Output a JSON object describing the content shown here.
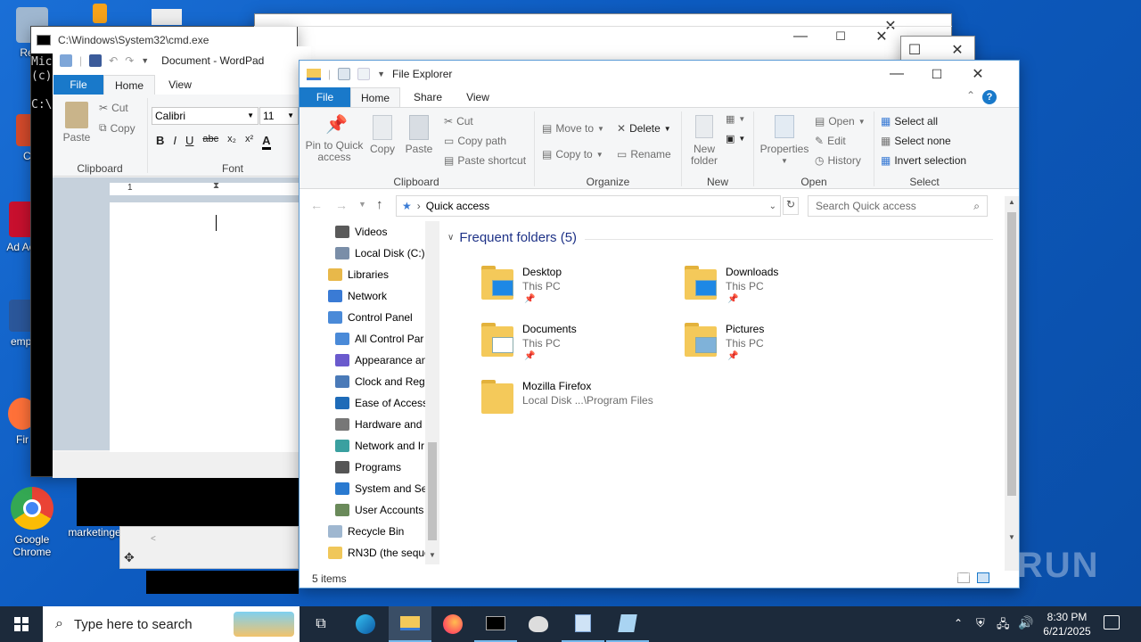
{
  "desktop": {
    "icons": [
      {
        "label": "Recy",
        "color": "#9fb7d0"
      },
      {
        "label": "CCl",
        "color": "#d44a2b"
      },
      {
        "label": "Ad Acr",
        "color": "#c8102e"
      },
      {
        "label": "empl",
        "color": "#2b579a"
      },
      {
        "label": "Fir",
        "color": "#ff7139"
      },
      {
        "label": "Google Chrome",
        "color": "#4285f4"
      },
      {
        "label": "marketinge",
        "color": "#bbbbbb"
      }
    ]
  },
  "cmd": {
    "title": "C:\\Windows\\System32\\cmd.exe",
    "lines": [
      "Mic",
      "(c)",
      "",
      "C:\\"
    ]
  },
  "wordpad": {
    "title": "Document - WordPad",
    "tabs": [
      "File",
      "Home",
      "View"
    ],
    "font_name": "Calibri",
    "font_size": "11",
    "clipboard": {
      "paste": "Paste",
      "cut": "Cut",
      "copy": "Copy",
      "group": "Clipboard"
    },
    "font_group": "Font",
    "ruler_mark": "1"
  },
  "explorer": {
    "title": "File Explorer",
    "tabs": [
      "File",
      "Home",
      "Share",
      "View"
    ],
    "ribbon": {
      "clipboard": {
        "pin": "Pin to Quick access",
        "copy": "Copy",
        "paste": "Paste",
        "cut": "Cut",
        "copy_path": "Copy path",
        "paste_shortcut": "Paste shortcut",
        "group": "Clipboard"
      },
      "organize": {
        "move_to": "Move to",
        "copy_to": "Copy to",
        "delete": "Delete",
        "rename": "Rename",
        "group": "Organize"
      },
      "new": {
        "new_folder": "New folder",
        "group": "New"
      },
      "open": {
        "properties": "Properties",
        "open": "Open",
        "edit": "Edit",
        "history": "History",
        "group": "Open"
      },
      "select": {
        "select_all": "Select all",
        "select_none": "Select none",
        "invert": "Invert selection",
        "group": "Select"
      }
    },
    "address": "Quick access",
    "search_placeholder": "Search Quick access",
    "nav": [
      {
        "label": "Videos",
        "color": "#5a5a5a",
        "indent": 1
      },
      {
        "label": "Local Disk (C:)",
        "color": "#7a8ea8",
        "indent": 1
      },
      {
        "label": "Libraries",
        "color": "#e8b84a",
        "indent": 0
      },
      {
        "label": "Network",
        "color": "#3a7bd5",
        "indent": 0
      },
      {
        "label": "Control Panel",
        "color": "#4a8ad8",
        "indent": 0
      },
      {
        "label": "All Control Par",
        "color": "#4a8ad8",
        "indent": 1
      },
      {
        "label": "Appearance an",
        "color": "#6a5acd",
        "indent": 1
      },
      {
        "label": "Clock and Regi",
        "color": "#4a7ab8",
        "indent": 1
      },
      {
        "label": "Ease of Access",
        "color": "#1e6bb8",
        "indent": 1
      },
      {
        "label": "Hardware and",
        "color": "#777777",
        "indent": 1
      },
      {
        "label": "Network and Ir",
        "color": "#3aa0a0",
        "indent": 1
      },
      {
        "label": "Programs",
        "color": "#555555",
        "indent": 1
      },
      {
        "label": "System and Se",
        "color": "#2a7ad0",
        "indent": 1
      },
      {
        "label": "User Accounts",
        "color": "#6a8a5a",
        "indent": 1
      },
      {
        "label": "Recycle Bin",
        "color": "#9fb7d0",
        "indent": 0
      },
      {
        "label": "RN3D (the seque",
        "color": "#f0c75a",
        "indent": 0
      }
    ],
    "group_title": "Frequent folders (5)",
    "folders": [
      {
        "name": "Desktop",
        "location": "This PC",
        "pinned": true,
        "badge": "#1e88e5"
      },
      {
        "name": "Downloads",
        "location": "This PC",
        "pinned": true,
        "badge": "#1e88e5"
      },
      {
        "name": "Documents",
        "location": "This PC",
        "pinned": true,
        "badge": "#ffffff"
      },
      {
        "name": "Pictures",
        "location": "This PC",
        "pinned": true,
        "badge": "#7fb2d9"
      },
      {
        "name": "Mozilla Firefox",
        "location": "Local Disk ...\\Program Files",
        "pinned": false,
        "badge": ""
      }
    ],
    "status": "5 items"
  },
  "taskbar": {
    "search_placeholder": "Type here to search",
    "time": "8:30 PM",
    "date": "6/21/2025"
  },
  "watermark": "ANY RUN",
  "colors": {
    "accent": "#1979ca",
    "folder": "#f4c95a",
    "taskbar": "#1c2a3b"
  }
}
